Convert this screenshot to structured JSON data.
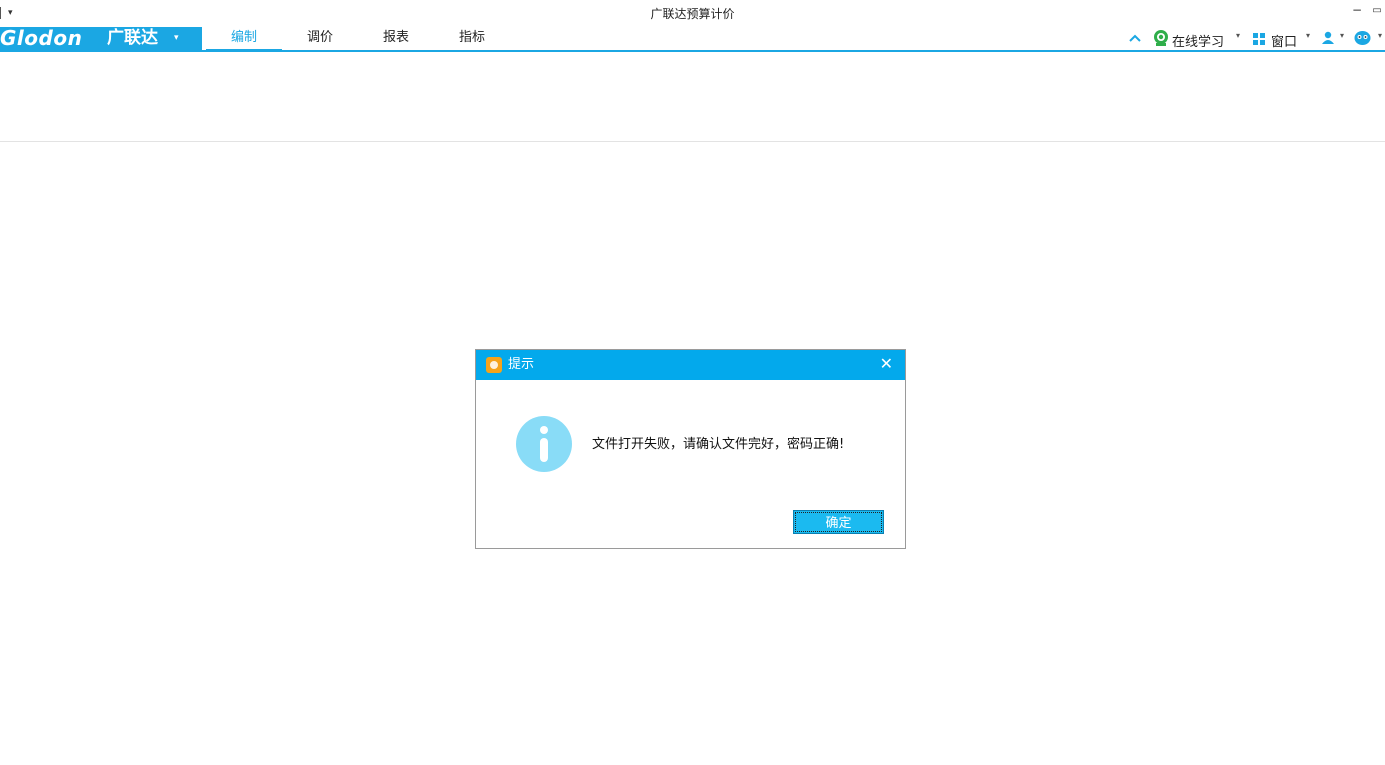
{
  "window": {
    "title": "广联达预算计价",
    "controls": [
      "−",
      "▭"
    ]
  },
  "brand": {
    "logo_text": "Glodon",
    "logo_cn": "广联达",
    "menu_arrow": "▾"
  },
  "tabs": [
    {
      "label": "编制",
      "active": true
    },
    {
      "label": "调价",
      "active": false
    },
    {
      "label": "报表",
      "active": false
    },
    {
      "label": "指标",
      "active": false
    }
  ],
  "toolbar_right": {
    "collapse_icon": "chevron-up-icon",
    "online_learning": "在线学习",
    "window_menu": "窗口",
    "user_icon": "user-icon",
    "assistant_icon": "assistant-icon"
  },
  "dialog": {
    "title": "提示",
    "message": "文件打开失败，请确认文件完好，密码正确!",
    "ok_label": "确定",
    "icon": "info-icon"
  },
  "colors": {
    "accent": "#1ba7e3",
    "dialog_header": "#03a9ec",
    "info_icon": "#89dcf7",
    "ok_button": "#1bbaf0"
  }
}
